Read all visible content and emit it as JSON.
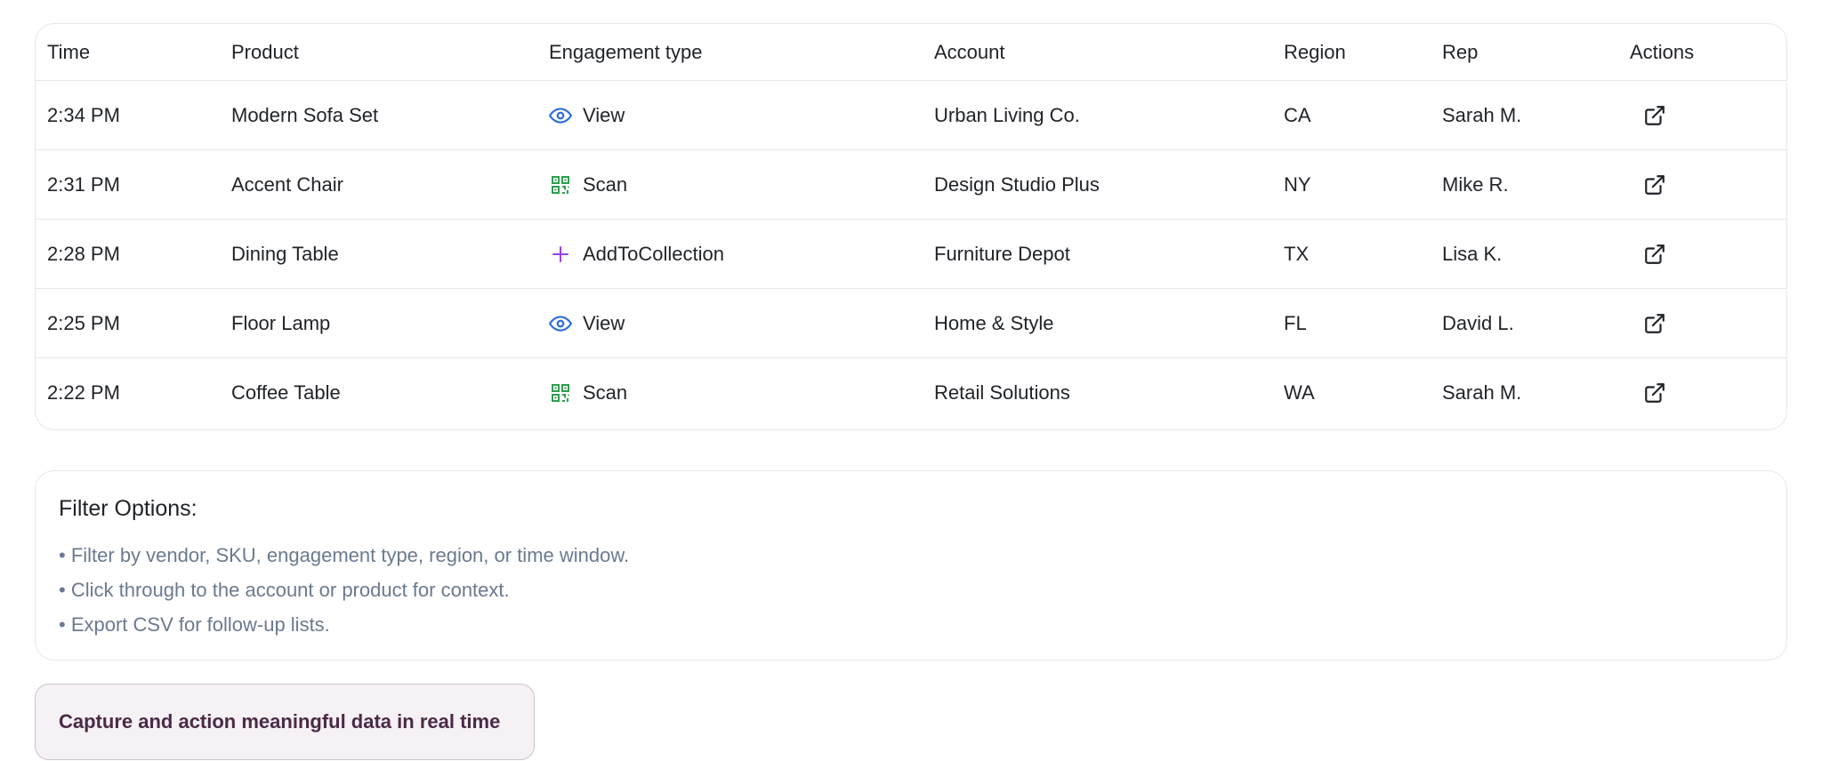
{
  "table": {
    "headers": {
      "time": "Time",
      "product": "Product",
      "engagement": "Engagement type",
      "account": "Account",
      "region": "Region",
      "rep": "Rep",
      "actions": "Actions"
    },
    "rows": [
      {
        "time": "2:34 PM",
        "product": "Modern Sofa Set",
        "engagement": "View",
        "engagement_icon": "eye-icon",
        "account": "Urban Living Co.",
        "region": "CA",
        "rep": "Sarah M.",
        "action_icon": "external-link-icon"
      },
      {
        "time": "2:31 PM",
        "product": "Accent Chair",
        "engagement": "Scan",
        "engagement_icon": "qr-code-icon",
        "account": "Design Studio Plus",
        "region": "NY",
        "rep": "Mike R.",
        "action_icon": "external-link-icon"
      },
      {
        "time": "2:28 PM",
        "product": "Dining Table",
        "engagement": "AddToCollection",
        "engagement_icon": "plus-icon",
        "account": "Furniture Depot",
        "region": "TX",
        "rep": "Lisa K.",
        "action_icon": "external-link-icon"
      },
      {
        "time": "2:25 PM",
        "product": "Floor Lamp",
        "engagement": "View",
        "engagement_icon": "eye-icon",
        "account": "Home & Style",
        "region": "FL",
        "rep": "David L.",
        "action_icon": "external-link-icon"
      },
      {
        "time": "2:22 PM",
        "product": "Coffee Table",
        "engagement": "Scan",
        "engagement_icon": "qr-code-icon",
        "account": "Retail Solutions",
        "region": "WA",
        "rep": "Sarah M.",
        "action_icon": "external-link-icon"
      }
    ]
  },
  "filters": {
    "title": "Filter Options:",
    "items": [
      "• Filter by vendor, SKU, engagement type, region, or time window.",
      "• Click through to the account or product for context.",
      "• Export CSV for follow-up lists."
    ]
  },
  "cta": {
    "label": "Capture and action meaningful data in real time"
  },
  "colors": {
    "view": "#2d6cdf",
    "scan": "#2e9e4f",
    "add": "#9b3fe0",
    "cta_text": "#4a2a45",
    "muted_text": "#6b7a8f"
  }
}
